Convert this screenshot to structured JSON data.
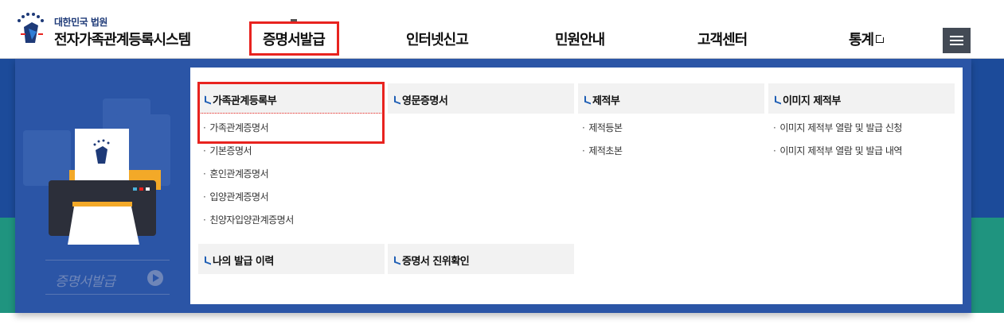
{
  "header": {
    "logo_small": "대한민국 법원",
    "logo_title": "전자가족관계등록시스템",
    "nav": [
      {
        "label": "증명서발급",
        "active": true
      },
      {
        "label": "인터넷신고"
      },
      {
        "label": "민원안내"
      },
      {
        "label": "고객센터"
      },
      {
        "label": "통계",
        "external": true
      }
    ],
    "menu_icon": "hamburger-icon"
  },
  "panel": {
    "side_button_label": "증명서발급",
    "side_button_icon": "play-circle-icon",
    "columns": [
      {
        "title": "가족관계등록부",
        "items": [
          "가족관계증명서",
          "기본증명서",
          "혼인관계증명서",
          "입양관계증명서",
          "친양자입양관계증명서"
        ]
      },
      {
        "title": "영문증명서",
        "items": []
      },
      {
        "title": "제적부",
        "items": [
          "제적등본",
          "제적초본"
        ]
      },
      {
        "title": "이미지 제적부",
        "items": [
          "이미지 제적부 열람 및 발급 신청",
          "이미지 제적부 열람 및 발급 내역"
        ]
      }
    ],
    "bottom_sections": [
      {
        "title": "나의 발급 이력"
      },
      {
        "title": "증명서 진위확인"
      }
    ]
  },
  "colors": {
    "highlight": "#e8231f",
    "panel_blue": "#2b55a6",
    "band_blue": "#1c4b9a",
    "band_teal": "#1f947f"
  }
}
